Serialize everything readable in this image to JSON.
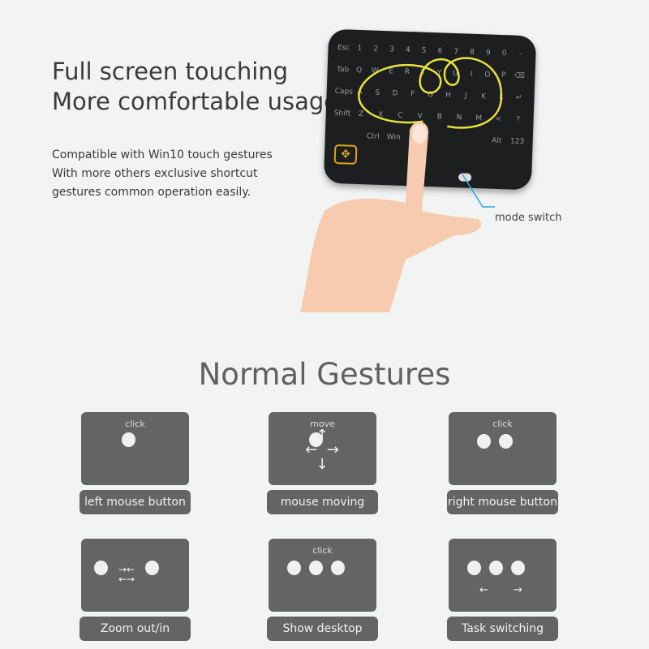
{
  "headline": {
    "line1": "Full screen touching",
    "line2": "More comfortable usage"
  },
  "description": {
    "line1": "Compatible with Win10 touch gestures",
    "line2": "With more others exclusive shortcut",
    "line3": "gestures common operation easily."
  },
  "keyboard": {
    "rows": [
      [
        "Esc",
        "1",
        "2",
        "3",
        "4",
        "5",
        "6",
        "7",
        "8",
        "9",
        "0",
        "-"
      ],
      [
        "Tab",
        "Q",
        "W",
        "E",
        "R",
        "T",
        "Y",
        "U",
        "I",
        "O",
        "P",
        "⌫"
      ],
      [
        "Caps",
        "A",
        "S",
        "D",
        "F",
        "G",
        "H",
        "J",
        "K",
        "L",
        "↵"
      ],
      [
        "Shift",
        "Z",
        "X",
        "C",
        "V",
        "B",
        "N",
        "M",
        "<",
        "?"
      ],
      [
        "Ctrl",
        "Win",
        "",
        "",
        "",
        "",
        "Alt",
        "123"
      ]
    ],
    "dpad": "✥",
    "accent": "#e0a21a",
    "trail_color": "#e8e23a"
  },
  "callout": {
    "mode_switch": "mode switch",
    "line_color": "#2aa8d8"
  },
  "section_title": "Normal Gestures",
  "gestures": [
    {
      "caption": "click",
      "label": "left mouse button"
    },
    {
      "caption": "move",
      "label": "mouse moving"
    },
    {
      "caption": "click",
      "label": "right mouse button"
    },
    {
      "caption": "",
      "label": "Zoom out/in"
    },
    {
      "caption": "click",
      "label": "Show desktop"
    },
    {
      "caption": "",
      "label": "Task switching"
    }
  ]
}
